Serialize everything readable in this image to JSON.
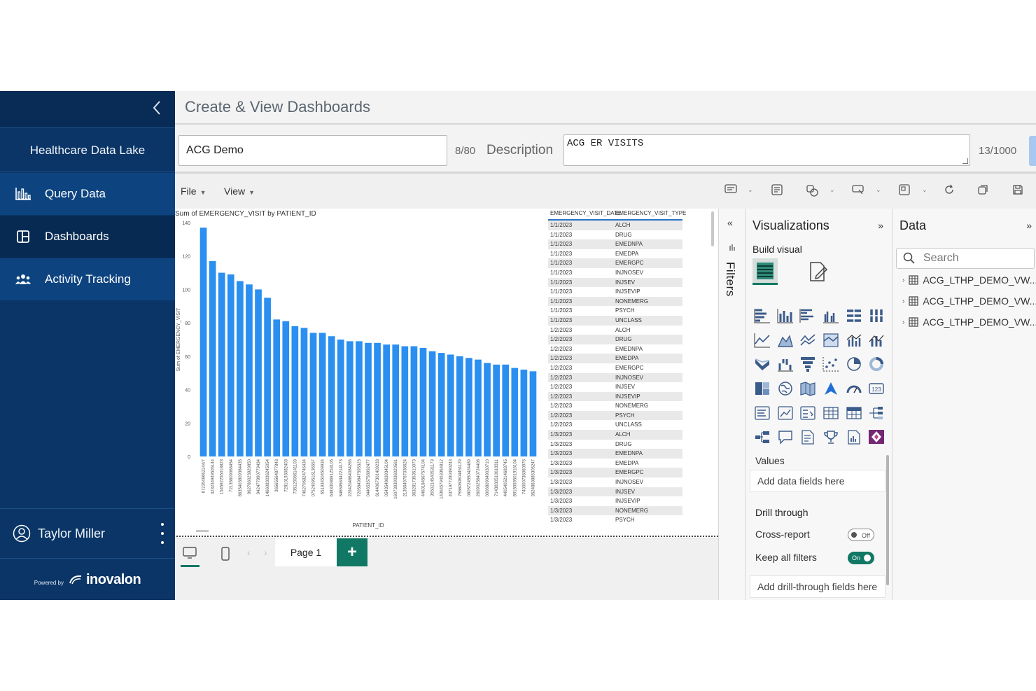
{
  "sidebar": {
    "app_name": "Healthcare Data Lake",
    "items": [
      {
        "label": "Query Data",
        "icon": "bar-chart-icon"
      },
      {
        "label": "Dashboards",
        "icon": "dashboard-icon"
      },
      {
        "label": "Activity Tracking",
        "icon": "users-icon"
      }
    ],
    "user_name": "Taylor Miller",
    "powered_by": "Powered by",
    "brand": "inovalon"
  },
  "header": {
    "title": "Create & View Dashboards"
  },
  "form": {
    "name_value": "ACG Demo",
    "name_count": "8/80",
    "description_label": "Description",
    "description_value": "ACG ER VISITS",
    "description_count": "13/1000"
  },
  "report": {
    "menus": {
      "file": "File",
      "view": "View"
    },
    "pages": {
      "page_label": "Page 1",
      "add": "+"
    },
    "filters_label": "Filters"
  },
  "chart_data": {
    "type": "bar",
    "title": "Sum of EMERGENCY_VISIT by PATIENT_ID",
    "xlabel": "PATIENT_ID",
    "ylabel": "Sum of EMERGENCY_VISIT",
    "ylim": [
      0,
      140
    ],
    "yticks": [
      0,
      20,
      40,
      60,
      80,
      100,
      120,
      140
    ],
    "color": "#2a8ff0",
    "categories": [
      "6723549662244/7",
      "423234949506144",
      "154592255018823",
      "72135609068454",
      "8635403809384435",
      "962766023929850",
      "942477990779434",
      "1466083036245054",
      "36565564877843",
      "72810193082403",
      "735120066141103",
      "7462706824746434",
      "0752409516136557",
      "651934504509934",
      "6483308691253105",
      "5465956342214173",
      "2294204664084265",
      "7205849847595323",
      "0446535758992477",
      "6144067301409233",
      "0543548639345104",
      "16073939036020561",
      "2135649767036624",
      "3632817353510073",
      "4460184567574104",
      "3550214540531173",
      "14364579453364812",
      "4371977280490243",
      "7556060604451129",
      "0805724550424489",
      "2609025640724406",
      "0006809049030710",
      "7143830510618311",
      "4405405214683745",
      "8918059501916104",
      "740000736060976",
      "3524883885305247"
    ],
    "values": [
      137,
      117,
      110,
      109,
      105,
      103,
      100,
      95,
      82,
      81,
      78,
      77,
      74,
      74,
      72,
      70,
      69,
      69,
      68,
      68,
      67,
      67,
      66,
      66,
      65,
      63,
      62,
      61,
      60,
      59,
      58,
      56,
      55,
      55,
      53,
      52,
      51
    ]
  },
  "table": {
    "headers": [
      "EMERGENCY_VISIT_DATE",
      "EMERGENCY_VISIT_TYPE"
    ],
    "rows": [
      [
        "1/1/2023",
        "ALCH"
      ],
      [
        "1/1/2023",
        "DRUG"
      ],
      [
        "1/1/2023",
        "EMEDNPA"
      ],
      [
        "1/1/2023",
        "EMEDPA"
      ],
      [
        "1/1/2023",
        "EMERGPC"
      ],
      [
        "1/1/2023",
        "INJNOSEV"
      ],
      [
        "1/1/2023",
        "INJSEV"
      ],
      [
        "1/1/2023",
        "INJSEVIP"
      ],
      [
        "1/1/2023",
        "NONEMERG"
      ],
      [
        "1/1/2023",
        "PSYCH"
      ],
      [
        "1/1/2023",
        "UNCLASS"
      ],
      [
        "1/2/2023",
        "ALCH"
      ],
      [
        "1/2/2023",
        "DRUG"
      ],
      [
        "1/2/2023",
        "EMEDNPA"
      ],
      [
        "1/2/2023",
        "EMEDPA"
      ],
      [
        "1/2/2023",
        "EMERGPC"
      ],
      [
        "1/2/2023",
        "INJNOSEV"
      ],
      [
        "1/2/2023",
        "INJSEV"
      ],
      [
        "1/2/2023",
        "INJSEVIP"
      ],
      [
        "1/2/2023",
        "NONEMERG"
      ],
      [
        "1/2/2023",
        "PSYCH"
      ],
      [
        "1/2/2023",
        "UNCLASS"
      ],
      [
        "1/3/2023",
        "ALCH"
      ],
      [
        "1/3/2023",
        "DRUG"
      ],
      [
        "1/3/2023",
        "EMEDNPA"
      ],
      [
        "1/3/2023",
        "EMEDPA"
      ],
      [
        "1/3/2023",
        "EMERGPC"
      ],
      [
        "1/3/2023",
        "INJNOSEV"
      ],
      [
        "1/3/2023",
        "INJSEV"
      ],
      [
        "1/3/2023",
        "INJSEVIP"
      ],
      [
        "1/3/2023",
        "NONEMERG"
      ],
      [
        "1/3/2023",
        "PSYCH"
      ]
    ]
  },
  "visualizations": {
    "title": "Visualizations",
    "build_label": "Build visual",
    "values_label": "Values",
    "values_placeholder": "Add data fields here",
    "drill_label": "Drill through",
    "cross_report_label": "Cross-report",
    "cross_report_state": "Off",
    "keep_filters_label": "Keep all filters",
    "keep_filters_state": "On",
    "drill_placeholder": "Add drill-through fields here"
  },
  "data_pane": {
    "title": "Data",
    "search_placeholder": "Search",
    "tables": [
      "ACG_LTHP_DEMO_VW...",
      "ACG_LTHP_DEMO_VW...",
      "ACG_LTHP_DEMO_VW..."
    ]
  },
  "colors": {
    "sidebar": "#0a3566",
    "accent": "#117865",
    "bar": "#2a8ff0"
  }
}
